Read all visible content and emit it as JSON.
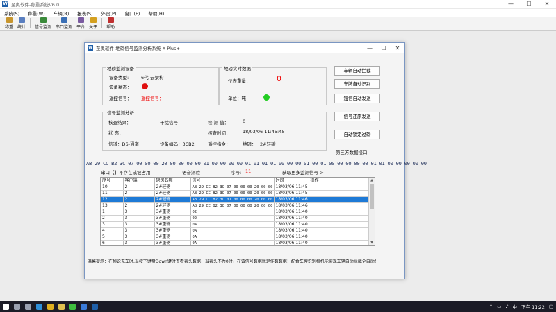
{
  "app": {
    "title": "至奥软件-称重系统V6.0",
    "logo_text": "W"
  },
  "window_controls": {
    "minimize": "—",
    "maximize": "☐",
    "close": "✕"
  },
  "menu": [
    {
      "label": "系统(S)"
    },
    {
      "label": "称重(W)"
    },
    {
      "label": "车辆(R)"
    },
    {
      "label": "报表(S)"
    },
    {
      "label": "外设(P)"
    },
    {
      "label": "窗口(F)"
    },
    {
      "label": "帮助(H)"
    }
  ],
  "toolbar": {
    "items": [
      {
        "label": "称重",
        "color": "#c8962e"
      },
      {
        "label": "统计",
        "color": "#5a7fc0"
      },
      {
        "label": "信号监测",
        "color": "#3a8a3a"
      },
      {
        "label": "串口监测",
        "color": "#3a6fb5"
      },
      {
        "label": "平台",
        "color": "#7a5aa0"
      },
      {
        "label": "关于",
        "color": "#d4a020"
      },
      {
        "label": "帮助",
        "color": "#c03030"
      }
    ]
  },
  "dialog": {
    "title": "至奥软件-地磅信号监测分析系统-X Plus+",
    "logo_text": "W",
    "device": {
      "legend": "地磅监测设备",
      "type_label": "设备类型:",
      "type_value": "6代-云架构",
      "status_label": "设备状态：",
      "status_color": "#e01010",
      "remote_label": "遥控信号：",
      "remote_value": "遥控信号："
    },
    "realtime": {
      "legend": "地磅实时数据",
      "weight_label": "仪表重量：",
      "weight_value": "0",
      "unit_label": "单位：吨",
      "unit_color": "#22cc22"
    },
    "analysis": {
      "legend": "信号监测分析",
      "check_result_label": "核查结果：",
      "check_result_value": "干扰信号",
      "check_value_label": "检 测 值：",
      "check_value": "0",
      "state_label": "状    态：",
      "check_time_label": "核查时间：",
      "check_time_value": "18/03/06 11:45:45",
      "channel_label": "信道：D6-通道",
      "device_code_label": "设备编码：3CB2",
      "remote_cmd_label": "遥控指令：",
      "scale_label": "地磅：",
      "scale_value": "2#轻磅"
    },
    "buttons": {
      "auto_intercept": "车辆自动拦截",
      "plate_recognition": "车牌自动识别",
      "sms_auto_send": "短信自动发送",
      "signal_restore": "信号还原发送",
      "auto_lock": "自动锁定过磅",
      "third_party": "第三方数据接口"
    },
    "hex_line": "AB 29 CC B2 3C 07 00 00 00 20 00 00 00 00 01 00 00 00 00 01 01 01 01 00 00 00 01 00 01 00 00 00 00 00 01 01 00 00 00 00 00",
    "serial": {
      "port_label": "串口【】不存在或被占用",
      "voice_label": "语音测验",
      "seq_label": "序号:",
      "seq_value": "11",
      "more_label": "获取更多监测信号->"
    },
    "grid": {
      "headers": [
        "序号",
        "客户端",
        "磅房名称",
        "信号",
        "时间",
        "操作"
      ],
      "rows": [
        {
          "seq": "10",
          "client": "2",
          "room": "2#轻磅",
          "signal": "AB 29 CC B2 3C 07 00 00 00 20 00 00 ...",
          "time": "18/03/06 11:45",
          "op": ""
        },
        {
          "seq": "11",
          "client": "2",
          "room": "2#轻磅",
          "signal": "AB 29 CC B2 3C 07 00 00 00 20 00 00 ...",
          "time": "18/03/06 11:45",
          "op": ""
        },
        {
          "seq": "12",
          "client": "2",
          "room": "2#轻磅",
          "signal": "AB 29 CC B2 3C 07 00 00 00 20 00 00 ...",
          "time": "18/03/06 11:46",
          "op": "",
          "selected": true
        },
        {
          "seq": "13",
          "client": "2",
          "room": "2#轻磅",
          "signal": "AB 29 CC B2 3C 07 00 00 00 20 00 00 ...",
          "time": "18/03/06 11:46",
          "op": ""
        },
        {
          "seq": "1",
          "client": "3",
          "room": "3#重磅",
          "signal": "02",
          "time": "18/03/06 11:40",
          "op": ""
        },
        {
          "seq": "2",
          "client": "3",
          "room": "3#重磅",
          "signal": "02",
          "time": "18/03/06 11:40",
          "op": ""
        },
        {
          "seq": "3",
          "client": "3",
          "room": "3#重磅",
          "signal": "0A",
          "time": "18/03/06 11:40",
          "op": ""
        },
        {
          "seq": "4",
          "client": "3",
          "room": "3#重磅",
          "signal": "0A",
          "time": "18/03/06 11:40",
          "op": ""
        },
        {
          "seq": "5",
          "client": "3",
          "room": "3#重磅",
          "signal": "0A",
          "time": "18/03/06 11:40",
          "op": ""
        },
        {
          "seq": "6",
          "client": "3",
          "room": "3#重磅",
          "signal": "0A",
          "time": "18/03/06 11:40",
          "op": ""
        }
      ]
    },
    "tip": "温馨提示：在称说无车时,当按下键盘Down键时查看表头数据，当表头不为0时，在该信号数据就是作数数据！配合车牌识别相机能实现车辆自动拦截全自动！"
  },
  "taskbar": {
    "icons": [
      {
        "name": "start",
        "color": "#ffffff"
      },
      {
        "name": "search",
        "color": "#9aa0b0"
      },
      {
        "name": "task-view",
        "color": "#9aa0b0"
      },
      {
        "name": "edge",
        "color": "#2f8fd8"
      },
      {
        "name": "chrome",
        "color": "#e0b020"
      },
      {
        "name": "explorer",
        "color": "#e0c050"
      },
      {
        "name": "wechat",
        "color": "#3fbf3f"
      },
      {
        "name": "store",
        "color": "#3a7ad8"
      },
      {
        "name": "app",
        "color": "#1f5fa8"
      }
    ],
    "input_method": "中",
    "time": "下午 11:22"
  }
}
